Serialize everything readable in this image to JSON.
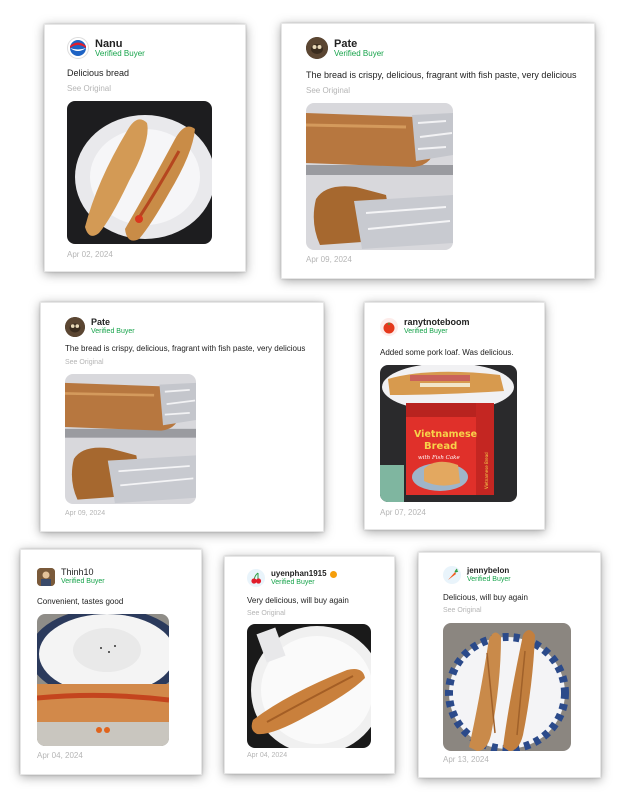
{
  "reviews": [
    {
      "username": "Nanu",
      "verified": "Verified Buyer",
      "text": "Delicious bread",
      "see_original": "See Original",
      "date": "Apr 02, 2024",
      "avatar_icon": "pepsi-logo-icon"
    },
    {
      "username": "Pate",
      "verified": "Verified Buyer",
      "text": "The bread is crispy, delicious, fragrant with fish paste, very delicious",
      "see_original": "See Original",
      "date": "Apr 09, 2024",
      "avatar_icon": "user-photo-icon"
    },
    {
      "username": "Pate",
      "verified": "Verified Buyer",
      "text": "The bread is crispy, delicious, fragrant with fish paste, very delicious",
      "see_original": "See Original",
      "date": "Apr 09, 2024",
      "avatar_icon": "user-photo-icon"
    },
    {
      "username": "ranytnoteboom",
      "verified": "Verified Buyer",
      "text": "Added some pork loaf. Was delicious.",
      "see_original": "",
      "date": "Apr 07, 2024",
      "avatar_icon": "tomato-icon"
    },
    {
      "username": "Thinh10",
      "verified": "Verified Buyer",
      "text": "Convenient, tastes good",
      "see_original": "",
      "date": "Apr 04, 2024",
      "avatar_icon": "user-photo-icon"
    },
    {
      "username": "uyenphan1915",
      "verified": "Verified Buyer",
      "text": "Very delicious, will buy again",
      "see_original": "See Original",
      "date": "Apr 04, 2024",
      "avatar_icon": "cherry-icon"
    },
    {
      "username": "jennybelon",
      "verified": "Verified Buyer",
      "text": "Delicious, will buy again",
      "see_original": "See Original",
      "date": "Apr 13, 2024",
      "avatar_icon": "carrot-icon"
    }
  ],
  "package": {
    "title_line1": "Vietnamese",
    "title_line2": "Bread",
    "subtitle": "with Fish Cake",
    "side_text": "Vietnamese Bread"
  },
  "colors": {
    "verified": "#16a34a",
    "muted": "#b5b5b5",
    "badge": "#f59e0b"
  }
}
